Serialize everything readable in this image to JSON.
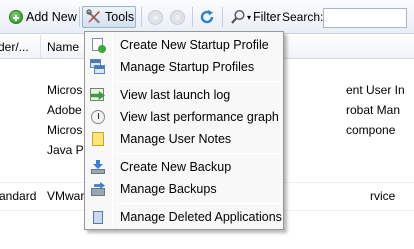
{
  "toolbar": {
    "add_new_label": "Add New",
    "tools_label": "Tools",
    "filter_label": "Filter",
    "search_label": "Search:",
    "search_value": ""
  },
  "grid": {
    "columns": [
      "der/...",
      "Name"
    ],
    "rows": [
      {
        "name": "Micros",
        "right": "ent User In"
      },
      {
        "name": "Adobe",
        "right": "robat Man"
      },
      {
        "name": "Micros",
        "right": "compone"
      },
      {
        "name": "Java Pla",
        "right": ""
      }
    ],
    "bottom_row": {
      "left": "andard",
      "name": "VMwar",
      "right": "rvice"
    }
  },
  "menu": {
    "groups": [
      [
        {
          "label": "Create New Startup Profile",
          "icon": "new-profile-icon"
        },
        {
          "label": "Manage Startup Profiles",
          "icon": "profiles-icon"
        }
      ],
      [
        {
          "label": "View last launch log",
          "icon": "launch-log-icon"
        },
        {
          "label": "View last performance graph",
          "icon": "performance-icon"
        },
        {
          "label": "Manage User Notes",
          "icon": "notes-icon"
        }
      ],
      [
        {
          "label": "Create New Backup",
          "icon": "backup-icon"
        },
        {
          "label": "Manage Backups",
          "icon": "manage-backups-icon"
        }
      ],
      [
        {
          "label": "Manage Deleted Applications",
          "icon": "deleted-apps-icon"
        }
      ]
    ]
  },
  "colors": {
    "toolbar_top": "#fbfcfe",
    "toolbar_bottom": "#e9eef6",
    "menu_bg": "#f8f8f8",
    "accent_blue": "#3b7fcf"
  }
}
